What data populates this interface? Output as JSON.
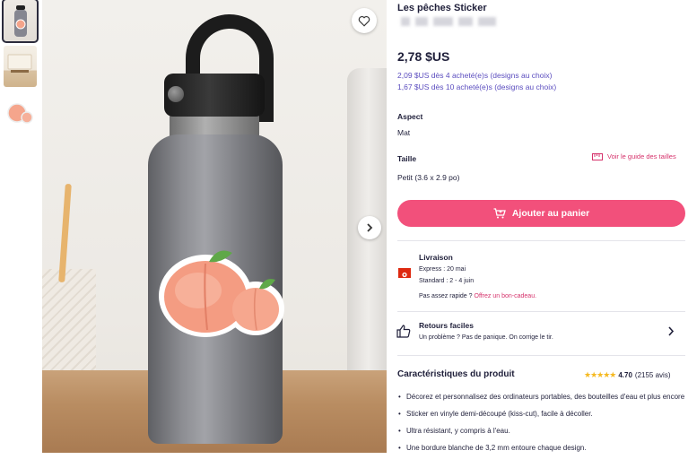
{
  "product": {
    "title": "Les pêches Sticker",
    "price": "2,78 $US",
    "bulk_prices": [
      "2,09 $US dès 4 acheté(e)s (designs au choix)",
      "1,67 $US dès 10 acheté(e)s (designs au choix)"
    ]
  },
  "options": {
    "finish_label": "Aspect",
    "finish_value": "Mat",
    "size_label": "Taille",
    "size_value": "Petit (3.6 x 2.9 po)",
    "size_guide_link": "Voir le guide des tailles"
  },
  "cart": {
    "button_label": "Ajouter au panier"
  },
  "shipping": {
    "heading": "Livraison",
    "express": "Express : 20 mai",
    "standard": "Standard : 2 - 4 juin",
    "not_fast_text": "Pas assez rapide ?",
    "gift_link": "Offrez un bon-cadeau."
  },
  "returns": {
    "heading": "Retours faciles",
    "text": "Un problème ? Pas de panique. On corrige le tir."
  },
  "characteristics": {
    "heading": "Caractéristiques du produit",
    "rating": "4.70",
    "reviews": "(2155 avis)",
    "stars": "★★★★★",
    "features": [
      "Décorez et personnalisez des ordinateurs portables, des bouteilles d'eau et plus encore",
      "Sticker en vinyle demi-découpé (kiss-cut), facile à décoller.",
      "Ultra résistant, y compris à l'eau.",
      "Une bordure blanche de 3,2 mm entoure chaque design."
    ]
  },
  "colors": {
    "accent": "#f2507b",
    "link_purple": "#5b4dbf",
    "link_pink": "#d6336c",
    "star": "#f5b920"
  },
  "icons": {
    "favorite": "heart-icon",
    "next": "chevron-right-icon",
    "size_guide": "ruler-icon",
    "cart": "cart-icon",
    "flag": "flag-icon",
    "returns": "thumbs-up-icon",
    "returns_more": "chevron-right-icon"
  }
}
